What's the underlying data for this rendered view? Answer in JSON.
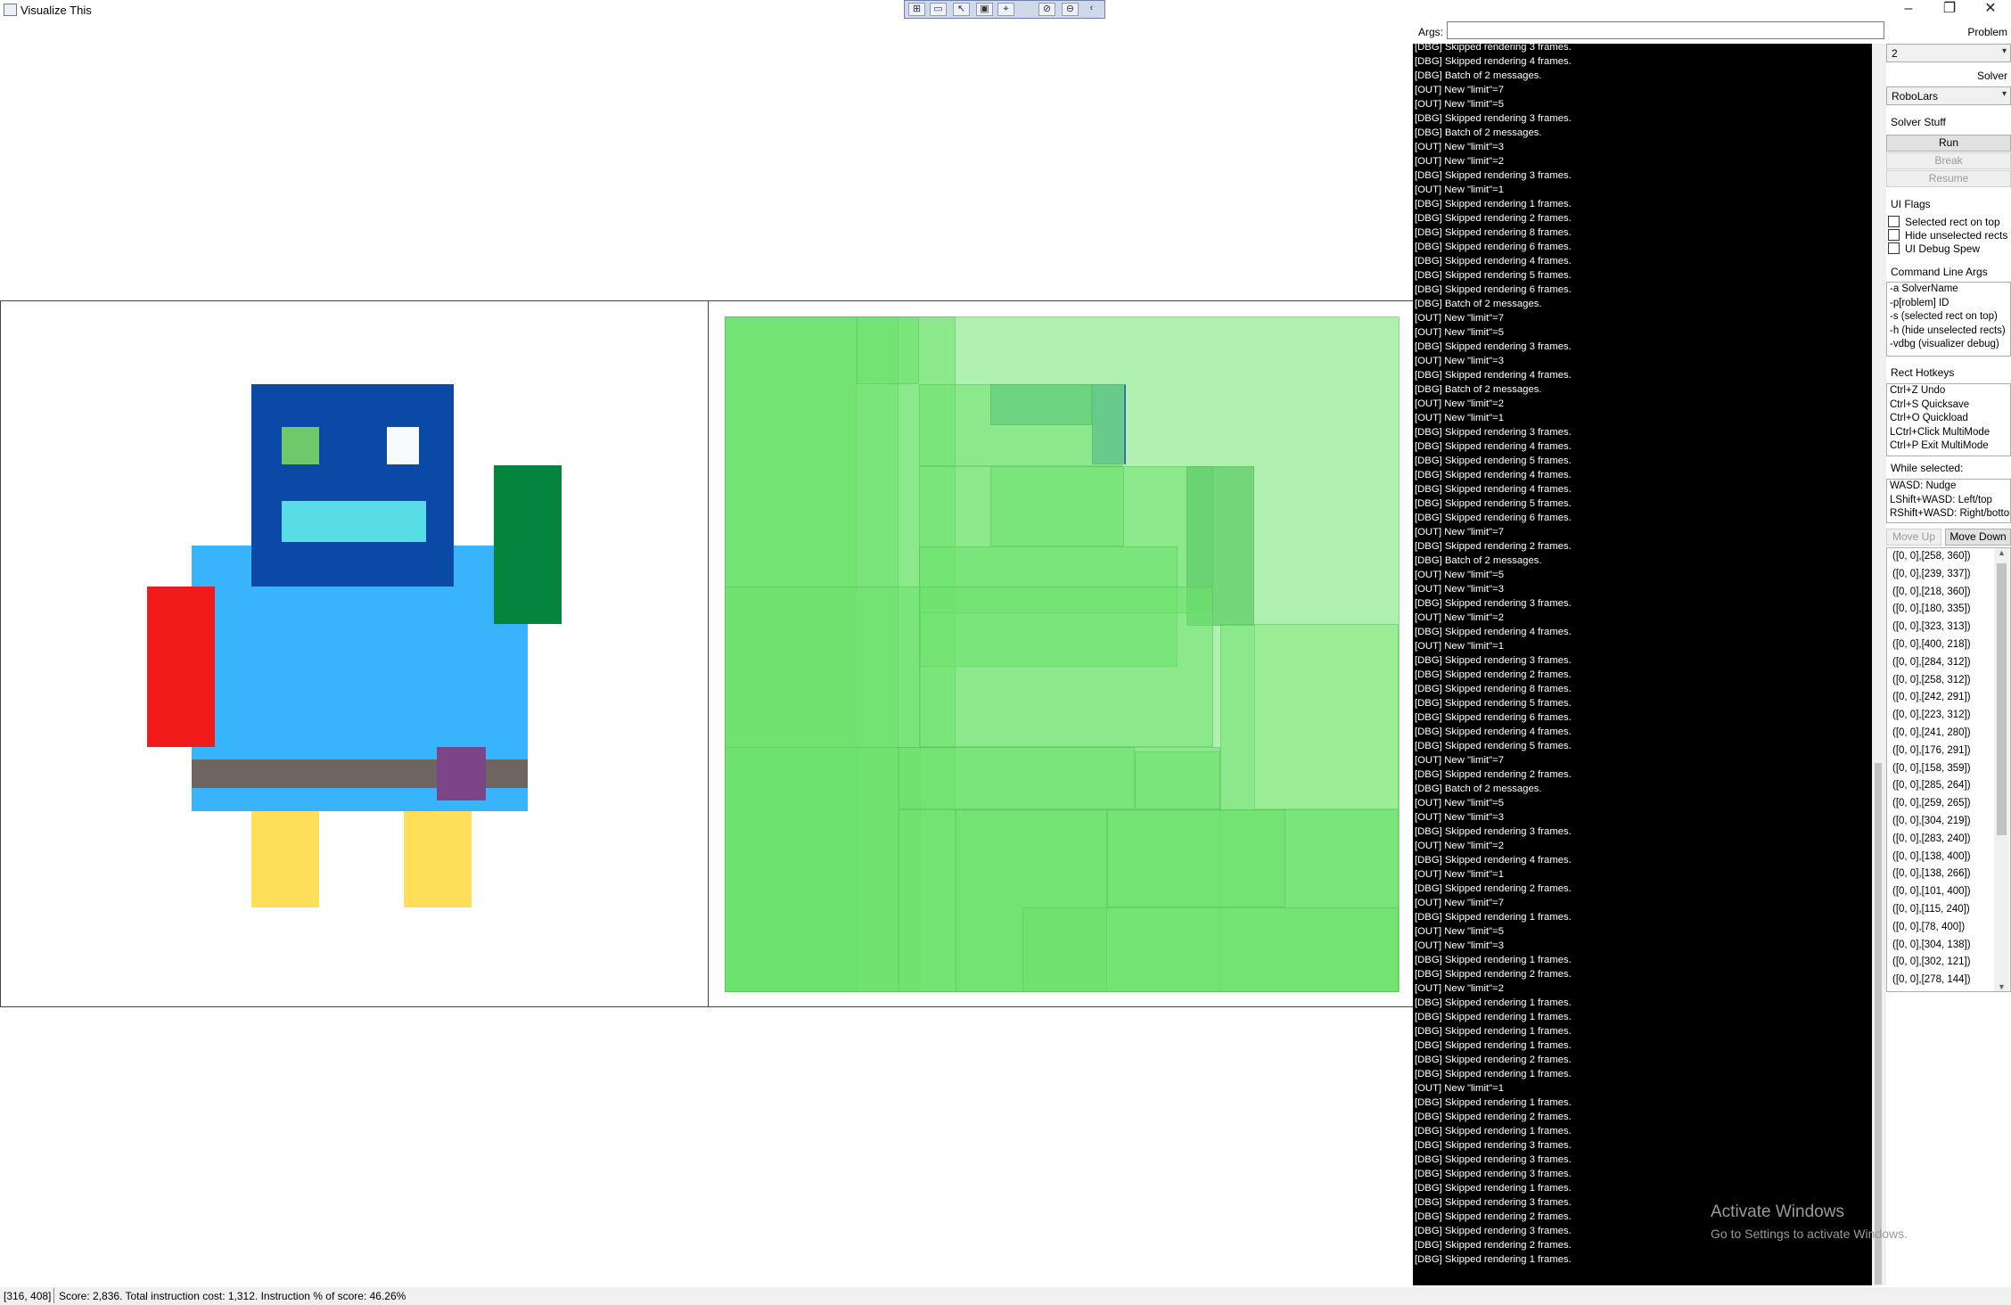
{
  "window": {
    "title": "Visualize This",
    "controls": {
      "minimize": "–",
      "restore": "❐",
      "close": "✕"
    }
  },
  "debug_toolbar": {
    "icons": [
      "select-element-icon",
      "record-icon",
      "pointer-icon",
      "layout-adorner-icon",
      "track-focus-icon",
      "binding-failures-icon",
      "stop-icon",
      "collapse-icon"
    ]
  },
  "colors": {
    "target_bg": "#ffffff",
    "head": "#0a4aa6",
    "body": "#38b4fc",
    "right_arm": "#04843c",
    "left_arm": "#f01a1a",
    "legs": "#ffde59",
    "belt": "#6e6560",
    "buckle": "#7b4587",
    "eye_left": "#6fc86a",
    "eye_right": "#f8fbfd",
    "mouth": "#58dce6",
    "rect_fill": "#7ee67e"
  },
  "args": {
    "label": "Args:",
    "value": ""
  },
  "log": {
    "lines": [
      "[DBG] Skipped rendering 3 frames.",
      "[DBG] Skipped rendering 4 frames.",
      "[DBG] Batch of 2 messages.",
      "[OUT] New \"limit\"=7",
      "[OUT] New \"limit\"=5",
      "[DBG] Skipped rendering 3 frames.",
      "[DBG] Batch of 2 messages.",
      "[OUT] New \"limit\"=3",
      "[OUT] New \"limit\"=2",
      "[DBG] Skipped rendering 3 frames.",
      "[OUT] New \"limit\"=1",
      "[DBG] Skipped rendering 1 frames.",
      "[DBG] Skipped rendering 2 frames.",
      "[DBG] Skipped rendering 8 frames.",
      "[DBG] Skipped rendering 6 frames.",
      "[DBG] Skipped rendering 4 frames.",
      "[DBG] Skipped rendering 5 frames.",
      "[DBG] Skipped rendering 6 frames.",
      "[DBG] Batch of 2 messages.",
      "[OUT] New \"limit\"=7",
      "[OUT] New \"limit\"=5",
      "[DBG] Skipped rendering 3 frames.",
      "[OUT] New \"limit\"=3",
      "[DBG] Skipped rendering 4 frames.",
      "[DBG] Batch of 2 messages.",
      "[OUT] New \"limit\"=2",
      "[OUT] New \"limit\"=1",
      "[DBG] Skipped rendering 3 frames.",
      "[DBG] Skipped rendering 4 frames.",
      "[DBG] Skipped rendering 5 frames.",
      "[DBG] Skipped rendering 4 frames.",
      "[DBG] Skipped rendering 4 frames.",
      "[DBG] Skipped rendering 5 frames.",
      "[DBG] Skipped rendering 6 frames.",
      "[OUT] New \"limit\"=7",
      "[DBG] Skipped rendering 2 frames.",
      "[DBG] Batch of 2 messages.",
      "[OUT] New \"limit\"=5",
      "[OUT] New \"limit\"=3",
      "[DBG] Skipped rendering 3 frames.",
      "[OUT] New \"limit\"=2",
      "[DBG] Skipped rendering 4 frames.",
      "[OUT] New \"limit\"=1",
      "[DBG] Skipped rendering 3 frames.",
      "[DBG] Skipped rendering 2 frames.",
      "[DBG] Skipped rendering 8 frames.",
      "[DBG] Skipped rendering 5 frames.",
      "[DBG] Skipped rendering 6 frames.",
      "[DBG] Skipped rendering 4 frames.",
      "[DBG] Skipped rendering 5 frames.",
      "[OUT] New \"limit\"=7",
      "[DBG] Skipped rendering 2 frames.",
      "[DBG] Batch of 2 messages.",
      "[OUT] New \"limit\"=5",
      "[OUT] New \"limit\"=3",
      "[DBG] Skipped rendering 3 frames.",
      "[OUT] New \"limit\"=2",
      "[DBG] Skipped rendering 4 frames.",
      "[OUT] New \"limit\"=1",
      "[DBG] Skipped rendering 2 frames.",
      "[OUT] New \"limit\"=7",
      "[DBG] Skipped rendering 1 frames.",
      "[OUT] New \"limit\"=5",
      "[OUT] New \"limit\"=3",
      "[DBG] Skipped rendering 1 frames.",
      "[DBG] Skipped rendering 2 frames.",
      "[OUT] New \"limit\"=2",
      "[DBG] Skipped rendering 1 frames.",
      "[DBG] Skipped rendering 1 frames.",
      "[DBG] Skipped rendering 1 frames.",
      "[DBG] Skipped rendering 1 frames.",
      "[DBG] Skipped rendering 2 frames.",
      "[DBG] Skipped rendering 1 frames.",
      "[OUT] New \"limit\"=1",
      "[DBG] Skipped rendering 1 frames.",
      "[DBG] Skipped rendering 2 frames.",
      "[DBG] Skipped rendering 1 frames.",
      "[DBG] Skipped rendering 3 frames.",
      "[DBG] Skipped rendering 3 frames.",
      "[DBG] Skipped rendering 3 frames.",
      "[DBG] Skipped rendering 1 frames.",
      "[DBG] Skipped rendering 3 frames.",
      "[DBG] Skipped rendering 2 frames.",
      "[DBG] Skipped rendering 3 frames.",
      "[DBG] Skipped rendering 2 frames.",
      "[DBG] Skipped rendering 1 frames."
    ]
  },
  "sidebar": {
    "problem_label": "Problem",
    "problem_value": "2",
    "solver_label": "Solver",
    "solver_value": "RoboLars",
    "solver_stuff_label": "Solver Stuff",
    "run_label": "Run",
    "break_label": "Break",
    "resume_label": "Resume",
    "ui_flags_label": "UI Flags",
    "flags": [
      {
        "label": "Selected rect on top",
        "checked": false
      },
      {
        "label": "Hide unselected rects",
        "checked": false
      },
      {
        "label": "UI Debug Spew",
        "checked": false
      }
    ],
    "cmd_args_label": "Command Line Args",
    "cmd_args": [
      "-a SolverName",
      "-p[roblem] ID",
      "-s (selected rect on top)",
      "-h (hide unselected rects)",
      "-vdbg (visualizer debug)"
    ],
    "hotkeys_label": "Rect Hotkeys",
    "hotkeys": [
      "Ctrl+Z Undo",
      "Ctrl+S Quicksave",
      "Ctrl+O Quickload",
      "LCtrl+Click MultiMode",
      "Ctrl+P Exit MultiMode"
    ],
    "while_selected_label": "While selected:",
    "while_selected": [
      "WASD: Nudge",
      "LShift+WASD: Left/top",
      "RShift+WASD: Right/bottom"
    ],
    "move_up_label": "Move Up",
    "move_down_label": "Move Down",
    "rects": [
      "([0, 0],[258, 360])",
      "([0, 0],[239, 337])",
      "([0, 0],[218, 360])",
      "([0, 0],[180, 335])",
      "([0, 0],[323, 313])",
      "([0, 0],[400, 218])",
      "([0, 0],[284, 312])",
      "([0, 0],[258, 312])",
      "([0, 0],[242, 291])",
      "([0, 0],[223, 312])",
      "([0, 0],[241, 280])",
      "([0, 0],[176, 291])",
      "([0, 0],[158, 359])",
      "([0, 0],[285, 264])",
      "([0, 0],[259, 265])",
      "([0, 0],[304, 219])",
      "([0, 0],[283, 240])",
      "([0, 0],[138, 400])",
      "([0, 0],[138, 266])",
      "([0, 0],[101, 400])",
      "([0, 0],[115, 240])",
      "([0, 0],[78, 400])",
      "([0, 0],[304, 138])",
      "([0, 0],[302, 121])",
      "([0, 0],[278, 144])"
    ]
  },
  "status": {
    "coords": "[316, 408]",
    "score_text": "Score: 2,836. Total instruction cost: 1,312. Instruction % of score: 46.26%"
  },
  "watermark": {
    "line1": "Activate Windows",
    "line2": "Go to Settings to activate Windows."
  }
}
